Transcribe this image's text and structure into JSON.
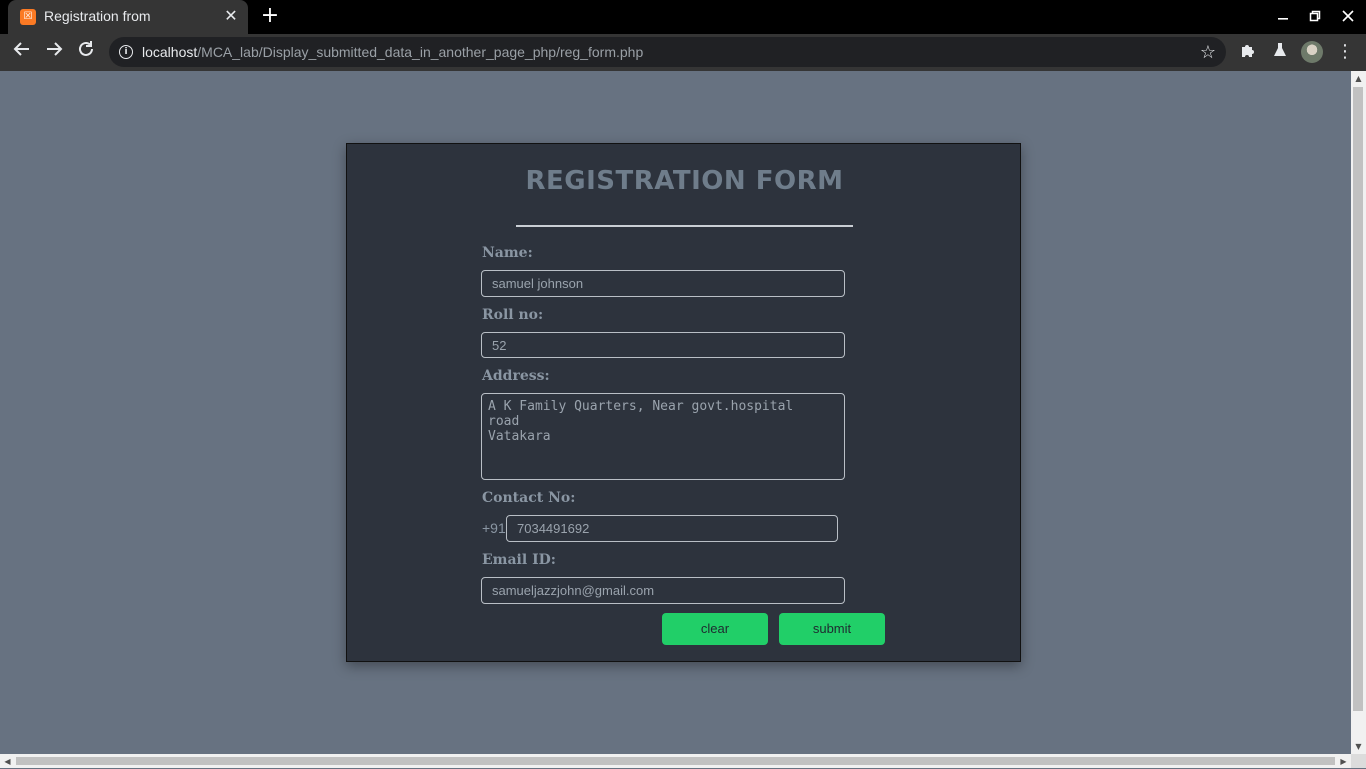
{
  "browser": {
    "tab_title": "Registration from",
    "tab_favicon_glyph": "☒",
    "new_tab_glyph": "+",
    "close_glyph": "✕",
    "url_host": "localhost",
    "url_path": "/MCA_lab/Display_submitted_data_in_another_page_php/reg_form.php",
    "icons": {
      "back": "arrow-left-icon",
      "forward": "arrow-right-icon",
      "reload": "reload-icon",
      "info": "info-icon",
      "star": "star-icon",
      "extensions": "puzzle-icon",
      "labs": "flask-icon",
      "menu": "kebab-menu-icon"
    }
  },
  "form": {
    "title": "REGISTRATION FORM",
    "name_label": "Name:",
    "name_value": "samuel johnson",
    "roll_label": "Roll no:",
    "roll_value": "52",
    "address_label": "Address:",
    "address_value": "A K Family Quarters, Near govt.hospital\nroad\nVatakara",
    "contact_label": "Contact No:",
    "contact_prefix": "+91",
    "contact_value": "7034491692",
    "email_label": "Email ID:",
    "email_value": "samueljazzjohn@gmail.com",
    "clear_label": "clear",
    "submit_label": "submit"
  },
  "colors": {
    "page_bg": "#677281",
    "card_bg": "#2d333d",
    "button_bg": "#21cf68",
    "title_color": "#6f7d8b"
  }
}
